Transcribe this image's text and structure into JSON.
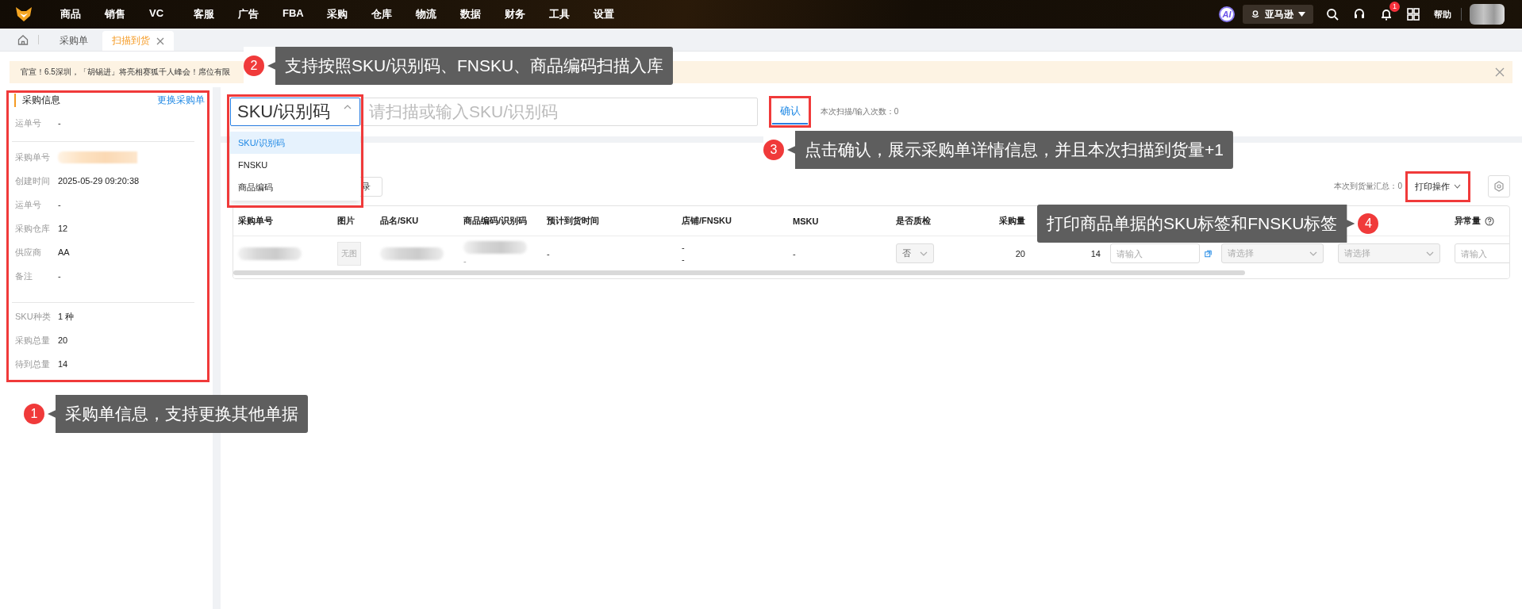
{
  "top_nav": {
    "menu": [
      "商品",
      "销售",
      "VC",
      "客服",
      "广告",
      "FBA",
      "采购",
      "仓库",
      "物流",
      "数据",
      "财务",
      "工具",
      "设置"
    ],
    "ai_label": "AI",
    "store_switch": "亚马逊",
    "notification_count": "1",
    "help": "帮助"
  },
  "tabs": [
    {
      "label": "采购单",
      "selected": false
    },
    {
      "label": "扫描到货",
      "selected": true
    }
  ],
  "notice": {
    "text": "官宣！6.5深圳，「胡锡进」将亮相赛狐千人峰会！席位有限"
  },
  "order_info": {
    "title": "采购信息",
    "change_link": "更换采购单",
    "sections": [
      [
        {
          "label": "运单号",
          "value": "-"
        }
      ],
      [
        {
          "label": "采购单号",
          "redacted": true
        },
        {
          "label": "创建时间",
          "value": "2025-05-29 09:20:38"
        },
        {
          "label": "运单号",
          "value": "-"
        },
        {
          "label": "采购仓库",
          "value": "12"
        },
        {
          "label": "供应商",
          "value": "AA"
        },
        {
          "label": "备注",
          "value": "-"
        }
      ],
      [
        {
          "label": "SKU种类",
          "value": "1 种"
        },
        {
          "label": "采购总量",
          "value": "20"
        },
        {
          "label": "待到总量",
          "value": "14"
        }
      ]
    ]
  },
  "scan": {
    "mode_select": {
      "value": "SKU/识别码",
      "expanded": true,
      "options": [
        {
          "label": "SKU/识别码",
          "selected": true
        },
        {
          "label": "FNSKU",
          "selected": false
        },
        {
          "label": "商品编码",
          "selected": false
        }
      ]
    },
    "placeholder": "请扫描或输入SKU/识别码",
    "confirm_button": "确认",
    "count_label": "本次扫描/输入次数：",
    "count": "0"
  },
  "toolbar": {
    "record_button": "录",
    "total_label": "本次到货量汇总：",
    "total": "0",
    "print_button": "打印操作"
  },
  "table": {
    "columns": [
      {
        "header": "采购单号"
      },
      {
        "header": "图片"
      },
      {
        "header": "品名/SKU"
      },
      {
        "header": "商品编码/识别码"
      },
      {
        "header": "预计到货时间"
      },
      {
        "header": "店铺/FNSKU"
      },
      {
        "header": "MSKU"
      },
      {
        "header": "是否质检"
      },
      {
        "header": "采购量"
      },
      {},
      {},
      {},
      {},
      {
        "header": "异常量",
        "help": true
      }
    ],
    "rows": [
      {
        "cells": [
          {
            "kind": "redacted"
          },
          {
            "kind": "thumb",
            "text": "无图"
          },
          {
            "kind": "redacted"
          },
          {
            "kind": "redacted",
            "sub": "-"
          },
          {
            "kind": "text",
            "text": "-"
          },
          {
            "kind": "stack",
            "lines": [
              "-",
              "-"
            ]
          },
          {
            "kind": "text",
            "text": "-"
          },
          {
            "kind": "select",
            "value": "否",
            "disabled": true
          },
          {
            "kind": "text",
            "text": "20"
          },
          {
            "kind": "text",
            "text": "14"
          },
          {
            "kind": "input",
            "placeholder": "请输入",
            "link": true
          },
          {
            "kind": "select",
            "placeholder": "请选择",
            "disabled": true
          },
          {
            "kind": "select",
            "placeholder": "请选择",
            "disabled": true
          },
          {
            "kind": "input",
            "placeholder": "请输入"
          }
        ]
      }
    ]
  },
  "annotations": [
    {
      "number": "1",
      "text": "采购单信息，支持更换其他单据"
    },
    {
      "number": "2",
      "text": "支持按照SKU/识别码、FNSKU、商品编码扫描入库"
    },
    {
      "number": "3",
      "text": "点击确认，展示采购单详情信息，并且本次扫描到货量+1"
    },
    {
      "number": "4",
      "text": "打印商品单据的SKU标签和FNSKU标签"
    }
  ]
}
